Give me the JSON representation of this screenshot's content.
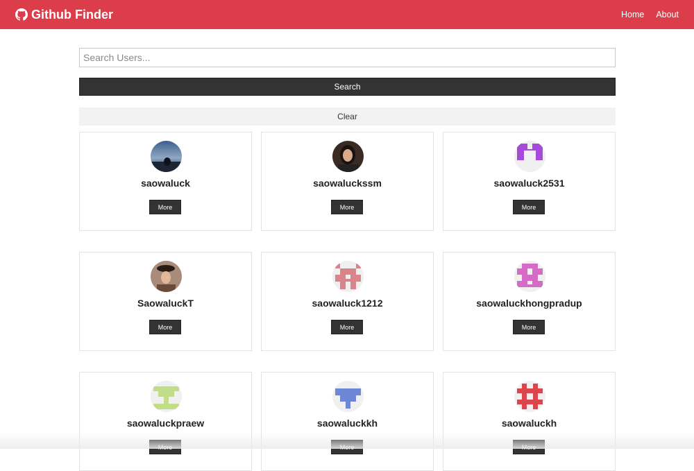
{
  "navbar": {
    "brand": "Github Finder",
    "links": [
      "Home",
      "About"
    ]
  },
  "search": {
    "placeholder": "Search Users...",
    "value": "",
    "search_label": "Search",
    "clear_label": "Clear"
  },
  "users": [
    {
      "login": "saowaluck",
      "more_label": "More",
      "avatar": "photo-landscape"
    },
    {
      "login": "saowaluckssm",
      "more_label": "More",
      "avatar": "photo-person"
    },
    {
      "login": "saowaluck2531",
      "more_label": "More",
      "avatar": "identicon-purple"
    },
    {
      "login": "SaowaluckT",
      "more_label": "More",
      "avatar": "photo-person-hat"
    },
    {
      "login": "saowaluck1212",
      "more_label": "More",
      "avatar": "identicon-pink"
    },
    {
      "login": "saowaluckhongpradup",
      "more_label": "More",
      "avatar": "identicon-magenta"
    },
    {
      "login": "saowaluckpraew",
      "more_label": "More",
      "avatar": "identicon-lime"
    },
    {
      "login": "saowaluckkh",
      "more_label": "More",
      "avatar": "identicon-blue"
    },
    {
      "login": "saowaluckh",
      "more_label": "More",
      "avatar": "identicon-red"
    }
  ],
  "colors": {
    "navbar": "#dc3d4b",
    "dark_button": "#333333",
    "light_button": "#f2f2f2"
  }
}
